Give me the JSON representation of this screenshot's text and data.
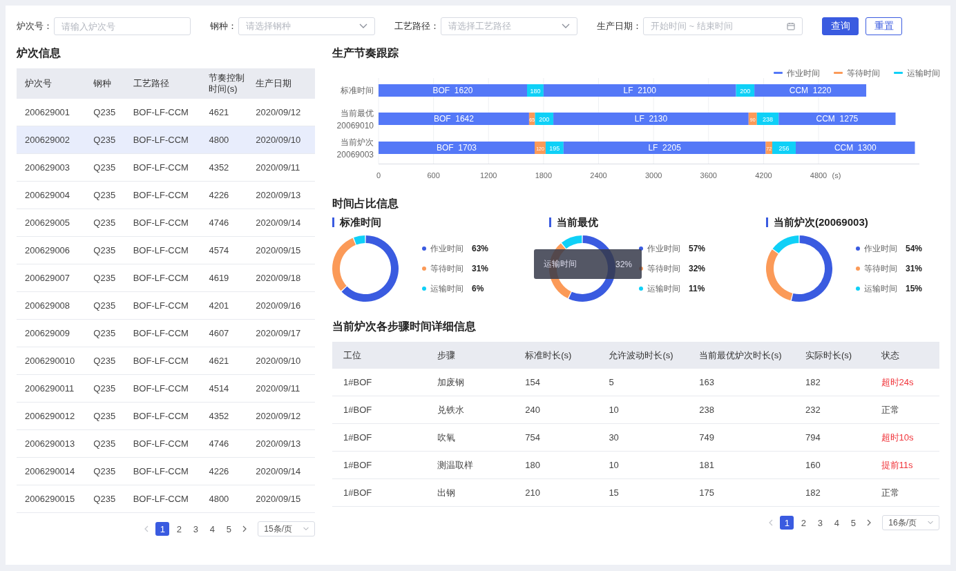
{
  "filters": [
    {
      "label": "炉次号：",
      "kind": "input",
      "placeholder": "请输入炉次号"
    },
    {
      "label": "钢种：",
      "kind": "select",
      "placeholder": "请选择钢种"
    },
    {
      "label": "工艺路径：",
      "kind": "select",
      "placeholder": "请选择工艺路径"
    },
    {
      "label": "生产日期：",
      "kind": "date",
      "placeholder": "开始时间 ~ 结束时间"
    }
  ],
  "buttons": [
    {
      "label": "查询",
      "primary": true
    },
    {
      "label": "重置",
      "primary": false
    }
  ],
  "heat_table": {
    "title": "炉次信息",
    "columns": [
      "炉次号",
      "钢种",
      "工艺路径",
      "节奏控制时间(s)",
      "生产日期"
    ],
    "rows": [
      {
        "cells": [
          "200629001",
          "Q235",
          "BOF-LF-CCM",
          "4621",
          "2020/09/12"
        ],
        "selected": false
      },
      {
        "cells": [
          "200629002",
          "Q235",
          "BOF-LF-CCM",
          "4800",
          "2020/09/10"
        ],
        "selected": true
      },
      {
        "cells": [
          "200629003",
          "Q235",
          "BOF-LF-CCM",
          "4352",
          "2020/09/11"
        ],
        "selected": false
      },
      {
        "cells": [
          "200629004",
          "Q235",
          "BOF-LF-CCM",
          "4226",
          "2020/09/13"
        ],
        "selected": false
      },
      {
        "cells": [
          "200629005",
          "Q235",
          "BOF-LF-CCM",
          "4746",
          "2020/09/14"
        ],
        "selected": false
      },
      {
        "cells": [
          "200629006",
          "Q235",
          "BOF-LF-CCM",
          "4574",
          "2020/09/15"
        ],
        "selected": false
      },
      {
        "cells": [
          "200629007",
          "Q235",
          "BOF-LF-CCM",
          "4619",
          "2020/09/18"
        ],
        "selected": false
      },
      {
        "cells": [
          "200629008",
          "Q235",
          "BOF-LF-CCM",
          "4201",
          "2020/09/16"
        ],
        "selected": false
      },
      {
        "cells": [
          "200629009",
          "Q235",
          "BOF-LF-CCM",
          "4607",
          "2020/09/17"
        ],
        "selected": false
      },
      {
        "cells": [
          "2006290010",
          "Q235",
          "BOF-LF-CCM",
          "4621",
          "2020/09/10"
        ],
        "selected": false
      },
      {
        "cells": [
          "2006290011",
          "Q235",
          "BOF-LF-CCM",
          "4514",
          "2020/09/11"
        ],
        "selected": false
      },
      {
        "cells": [
          "2006290012",
          "Q235",
          "BOF-LF-CCM",
          "4352",
          "2020/09/12"
        ],
        "selected": false
      },
      {
        "cells": [
          "2006290013",
          "Q235",
          "BOF-LF-CCM",
          "4746",
          "2020/09/13"
        ],
        "selected": false
      },
      {
        "cells": [
          "2006290014",
          "Q235",
          "BOF-LF-CCM",
          "4226",
          "2020/09/14"
        ],
        "selected": false
      },
      {
        "cells": [
          "2006290015",
          "Q235",
          "BOF-LF-CCM",
          "4800",
          "2020/09/15"
        ],
        "selected": false
      }
    ],
    "pagination": {
      "pages": [
        {
          "label": "1",
          "selected": true
        },
        {
          "label": "2",
          "selected": false
        },
        {
          "label": "3",
          "selected": false
        },
        {
          "label": "4",
          "selected": false
        },
        {
          "label": "5",
          "selected": false
        }
      ],
      "page_size": "15条/页"
    }
  },
  "rhythm": {
    "title": "生产节奏跟踪",
    "chart_data": {
      "type": "bar",
      "orientation": "horizontal",
      "stacked": true,
      "data_labels": "value_labels",
      "grid": true,
      "legend": "top-right",
      "categories": [
        "标准时间",
        "当前最优 20069010",
        "当前炉次 20069003"
      ],
      "xlabel": "(s)",
      "xlim": [
        0,
        5900
      ],
      "xticks": [
        0,
        600,
        1200,
        1800,
        2400,
        3000,
        3600,
        4200,
        {
          "value": 4800,
          "label": "4800"
        }
      ],
      "series": [
        {
          "name": "作业时间",
          "color": "#5478f7",
          "values": [
            1620,
            1642,
            1703
          ],
          "value_labels": [
            "BOF  1620",
            "BOF  1642",
            "BOF  1703"
          ]
        },
        {
          "name": "等待时间",
          "color": "#fb9a58",
          "values": [
            null,
            65,
            120
          ],
          "value_labels": [
            null,
            "65",
            "120"
          ]
        },
        {
          "name": "运输时间",
          "color": "#0fd0f7",
          "values": [
            180,
            200,
            195
          ],
          "value_labels": [
            "180",
            "200",
            "195"
          ]
        },
        {
          "color": "#5478f7",
          "values": [
            2100,
            2130,
            2205
          ],
          "value_labels": [
            "LF  2100",
            "LF  2130",
            "LF  2205"
          ]
        },
        {
          "color": "#fb9a58",
          "values": [
            null,
            90,
            72
          ],
          "value_labels": [
            null,
            "90",
            "72"
          ]
        },
        {
          "color": "#0fd0f7",
          "values": [
            200,
            238,
            256
          ],
          "value_labels": [
            "200",
            "238",
            "256"
          ]
        },
        {
          "color": "#5478f7",
          "values": [
            1220,
            1275,
            1300
          ],
          "value_labels": [
            "CCM  1220",
            "CCM  1275",
            "CCM  1300"
          ]
        }
      ]
    }
  },
  "ratio": {
    "title": "时间占比信息",
    "panels": [
      {
        "title": "标准时间",
        "chart_data": {
          "type": "donut",
          "categories": [
            "作业时间",
            "等待时间",
            "运输时间"
          ],
          "values": [
            63,
            31,
            6
          ]
        },
        "legend": [
          {
            "value": "63%",
            "color": "#3a5be0"
          },
          {
            "value": "31%",
            "color": "#fb9a58"
          },
          {
            "value": "6%",
            "color": "#0fd0f7"
          }
        ]
      },
      {
        "title": "当前最优",
        "chart_data": {
          "type": "donut",
          "categories": [
            "作业时间",
            "等待时间",
            "运输时间"
          ],
          "values": [
            57,
            32,
            11
          ]
        },
        "legend": [
          {
            "value": "57%",
            "color": "#3a5be0"
          },
          {
            "value": "32%",
            "color": "#fb9a58"
          },
          {
            "value": "11%",
            "color": "#0fd0f7"
          }
        ],
        "tooltip": {
          "label": "运输时间",
          "value": "32%"
        }
      },
      {
        "title": "当前炉次(20069003)",
        "chart_data": {
          "type": "donut",
          "categories": [
            "作业时间",
            "等待时间",
            "运输时间"
          ],
          "values": [
            54,
            31,
            15
          ]
        },
        "legend": [
          {
            "value": "54%",
            "color": "#3a5be0"
          },
          {
            "value": "31%",
            "color": "#fb9a58"
          },
          {
            "value": "15%",
            "color": "#0fd0f7"
          }
        ]
      }
    ]
  },
  "steps_table": {
    "title": "当前炉次各步骤时间详细信息",
    "columns": [
      "工位",
      "步骤",
      "标准时长(s)",
      "允许波动时长(s)",
      "当前最优炉次时长(s)",
      "实际时长(s)",
      "状态"
    ],
    "rows": [
      {
        "cells": [
          "1#BOF",
          "加废钢",
          "154",
          "5",
          "163",
          "182",
          "超时24s"
        ],
        "alert": true
      },
      {
        "cells": [
          "1#BOF",
          "兑铁水",
          "240",
          "10",
          "238",
          "232",
          "正常"
        ],
        "alert": false
      },
      {
        "cells": [
          "1#BOF",
          "吹氧",
          "754",
          "30",
          "749",
          "794",
          "超时10s"
        ],
        "alert": true
      },
      {
        "cells": [
          "1#BOF",
          "测温取样",
          "180",
          "10",
          "181",
          "160",
          "提前11s"
        ],
        "alert": true
      },
      {
        "cells": [
          "1#BOF",
          "出钢",
          "210",
          "15",
          "175",
          "182",
          "正常"
        ],
        "alert": false
      }
    ],
    "pagination": {
      "pages": [
        {
          "label": "1",
          "selected": true
        },
        {
          "label": "2",
          "selected": false
        },
        {
          "label": "3",
          "selected": false
        },
        {
          "label": "4",
          "selected": false
        },
        {
          "label": "5",
          "selected": false
        }
      ],
      "page_size": "16条/页"
    }
  }
}
